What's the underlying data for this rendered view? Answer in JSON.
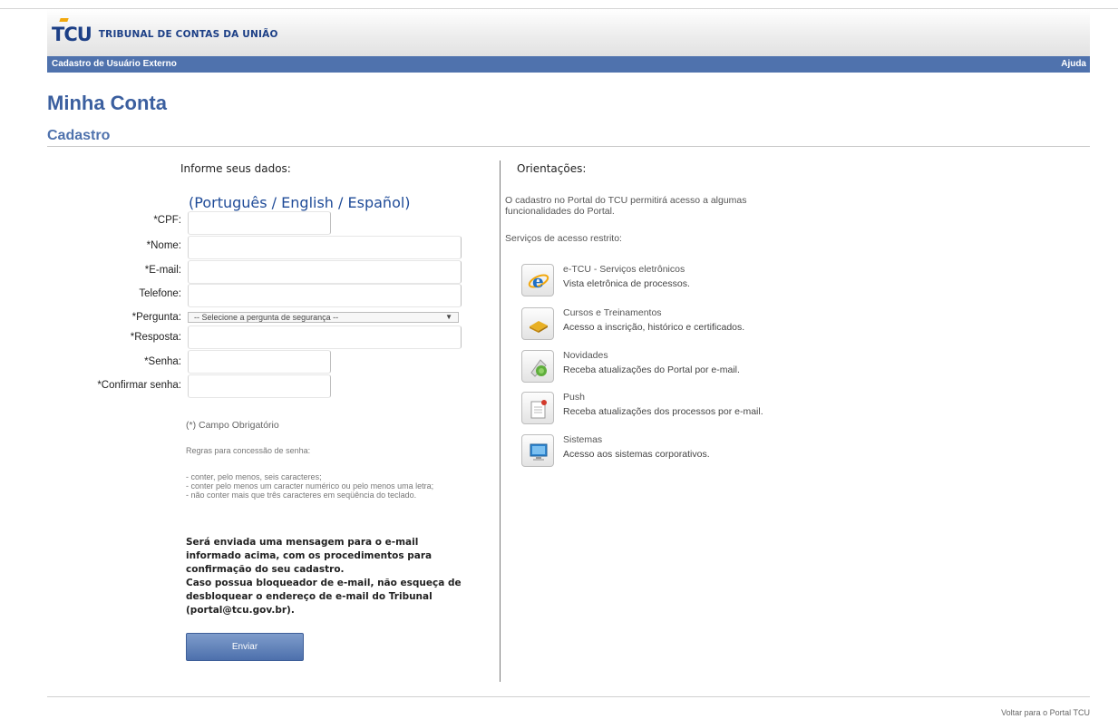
{
  "header": {
    "logo_mark": "TCU",
    "logo_name": "TRIBUNAL DE CONTAS DA UNIÃO"
  },
  "navbar": {
    "left_label": "Cadastro de Usuário Externo",
    "help_label": "Ajuda"
  },
  "page": {
    "title": "Minha Conta",
    "section": "Cadastro"
  },
  "form": {
    "heading": "Informe seus dados:",
    "languages": [
      "(Português",
      "/",
      "English",
      "/",
      "Español)"
    ],
    "fields": {
      "cpf": "*CPF:",
      "nome": "*Nome:",
      "email": "*E-mail:",
      "telefone": "Telefone:",
      "pergunta": "*Pergunta:",
      "resposta": "*Resposta:",
      "senha": "*Senha:",
      "confirmar": "*Confirmar senha:"
    },
    "question_placeholder": "-- Selecione a pergunta de segurança --",
    "required_note": "(*) Campo Obrigatório",
    "password_rules_title": "Regras para concessão de senha:",
    "password_rules": [
      "- conter, pelo menos, seis caracteres;",
      "- conter pelo menos um caracter numérico ou pelo menos uma letra;",
      "- não conter mais que três caracteres em seqüência do teclado."
    ],
    "confirmation_message": "Será enviada uma mensagem para o e-mail informado acima, com os procedimentos para confirmação do seu cadastro.",
    "blocker_message": "Caso possua bloqueador de e-mail, não esqueça de desbloquear o endereço de e-mail do Tribunal (portal@tcu.gov.br).",
    "submit_label": "Enviar"
  },
  "guidance": {
    "heading": "Orientações:",
    "intro": "O cadastro no Portal do TCU permitirá acesso a algumas funcionalidades do Portal.",
    "services_title": "Serviços de acesso restrito:",
    "services": [
      {
        "icon": "e-tcu-icon",
        "title": "e-TCU - Serviços eletrônicos",
        "desc": "Vista eletrônica de processos."
      },
      {
        "icon": "courses-icon",
        "title": "Cursos e Treinamentos",
        "desc": "Acesso a inscrição, histórico e certificados."
      },
      {
        "icon": "news-icon",
        "title": "Novidades",
        "desc": "Receba atualizações do Portal por e-mail."
      },
      {
        "icon": "push-icon",
        "title": "Push",
        "desc": "Receba atualizações dos processos por e-mail."
      },
      {
        "icon": "systems-icon",
        "title": "Sistemas",
        "desc": "Acesso aos sistemas corporativos."
      }
    ]
  },
  "footer": {
    "back_link": "Voltar para o Portal TCU"
  },
  "colors": {
    "brand_blue": "#1c3f86",
    "nav_blue": "#4f72ad",
    "title_blue": "#3b5f9f",
    "accent_orange": "#f2a80d"
  }
}
